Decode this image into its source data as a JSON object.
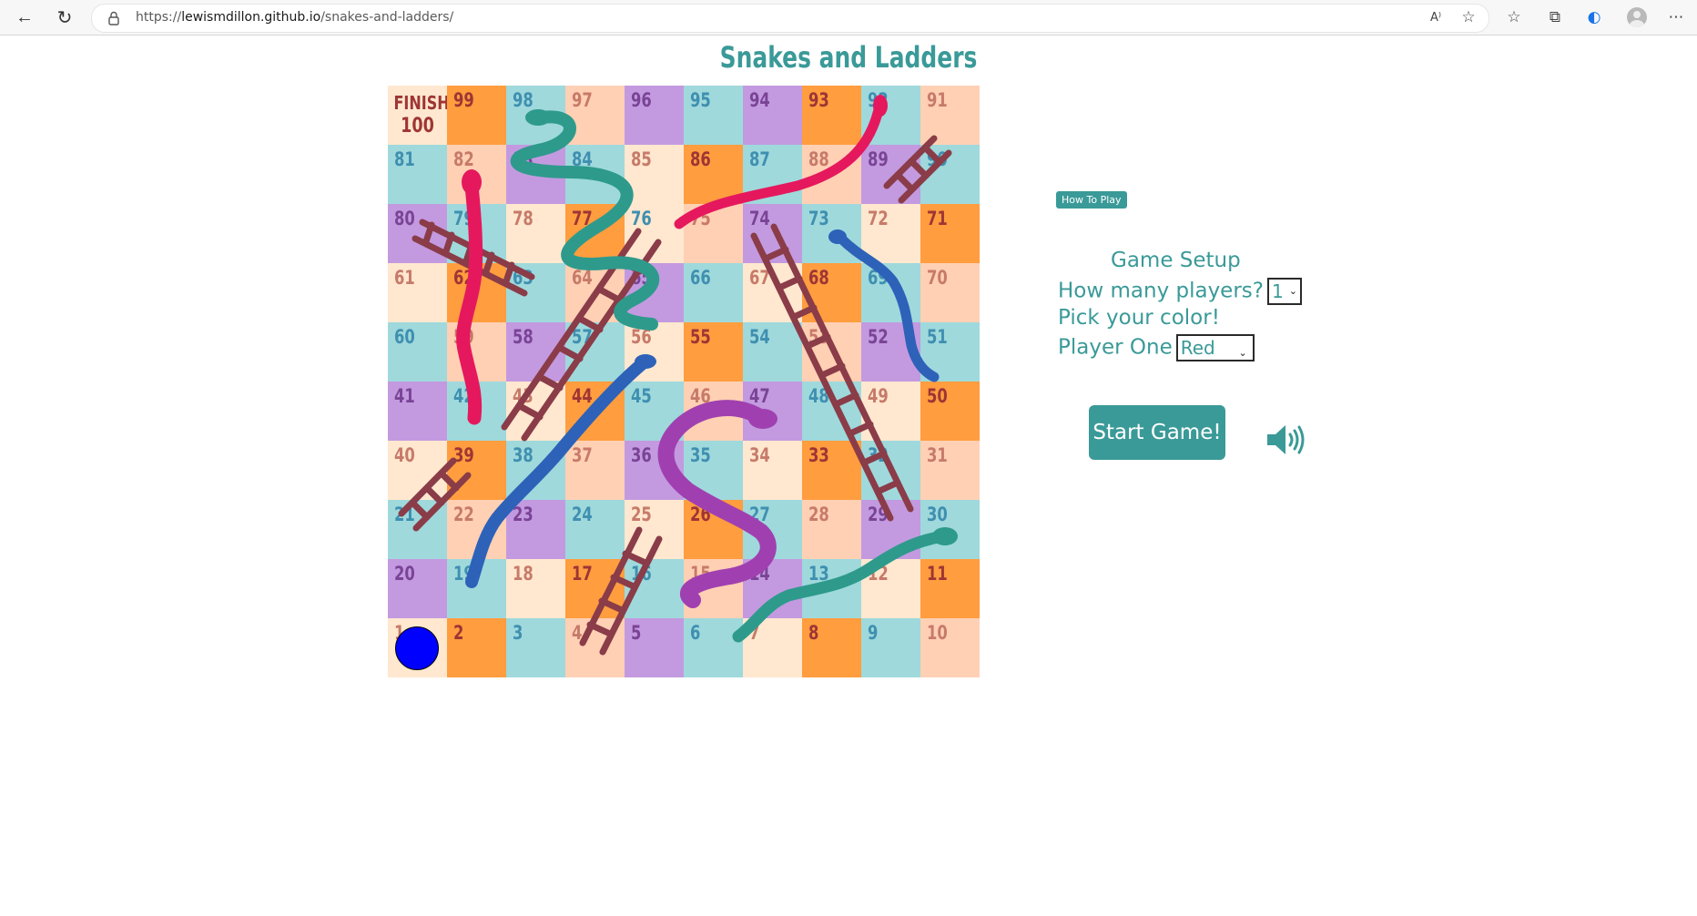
{
  "browser": {
    "url_prefix": "https://",
    "url_host": "lewismdillon.github.io",
    "url_path": "/snakes-and-ladders/"
  },
  "page": {
    "title": "Snakes and Ladders"
  },
  "board": {
    "finish_label": "FINISH",
    "cells": [
      {
        "n": "100",
        "bg": "#ffe8cf",
        "fg": "#9e3535"
      },
      {
        "n": "99",
        "bg": "#ff9d3f",
        "fg": "#9e3535"
      },
      {
        "n": "98",
        "bg": "#9fd9dc",
        "fg": "#3f8fb0"
      },
      {
        "n": "97",
        "bg": "#ffd0b4",
        "fg": "#c77a6a"
      },
      {
        "n": "96",
        "bg": "#c39ae0",
        "fg": "#7a4496"
      },
      {
        "n": "95",
        "bg": "#9fd9dc",
        "fg": "#3f8fb0"
      },
      {
        "n": "94",
        "bg": "#c39ae0",
        "fg": "#7a4496"
      },
      {
        "n": "93",
        "bg": "#ff9d3f",
        "fg": "#9e3535"
      },
      {
        "n": "92",
        "bg": "#9fd9dc",
        "fg": "#3f8fb0"
      },
      {
        "n": "91",
        "bg": "#ffd0b4",
        "fg": "#c77a6a"
      },
      {
        "n": "81",
        "bg": "#9fd9dc",
        "fg": "#3f8fb0"
      },
      {
        "n": "82",
        "bg": "#ffd0b4",
        "fg": "#c77a6a"
      },
      {
        "n": "83",
        "bg": "#c39ae0",
        "fg": "#7a4496"
      },
      {
        "n": "84",
        "bg": "#9fd9dc",
        "fg": "#3f8fb0"
      },
      {
        "n": "85",
        "bg": "#ffe8cf",
        "fg": "#c77a6a"
      },
      {
        "n": "86",
        "bg": "#ff9d3f",
        "fg": "#9e3535"
      },
      {
        "n": "87",
        "bg": "#9fd9dc",
        "fg": "#3f8fb0"
      },
      {
        "n": "88",
        "bg": "#ffd0b4",
        "fg": "#c77a6a"
      },
      {
        "n": "89",
        "bg": "#c39ae0",
        "fg": "#7a4496"
      },
      {
        "n": "90",
        "bg": "#9fd9dc",
        "fg": "#3f8fb0"
      },
      {
        "n": "80",
        "bg": "#c39ae0",
        "fg": "#7a4496"
      },
      {
        "n": "79",
        "bg": "#9fd9dc",
        "fg": "#3f8fb0"
      },
      {
        "n": "78",
        "bg": "#ffe8cf",
        "fg": "#c77a6a"
      },
      {
        "n": "77",
        "bg": "#ff9d3f",
        "fg": "#9e3535"
      },
      {
        "n": "76",
        "bg": "#ffe8cf",
        "fg": "#3f8fb0"
      },
      {
        "n": "75",
        "bg": "#ffd0b4",
        "fg": "#c77a6a"
      },
      {
        "n": "74",
        "bg": "#c39ae0",
        "fg": "#7a4496"
      },
      {
        "n": "73",
        "bg": "#9fd9dc",
        "fg": "#3f8fb0"
      },
      {
        "n": "72",
        "bg": "#ffe8cf",
        "fg": "#c77a6a"
      },
      {
        "n": "71",
        "bg": "#ff9d3f",
        "fg": "#9e3535"
      },
      {
        "n": "61",
        "bg": "#ffe8cf",
        "fg": "#c77a6a"
      },
      {
        "n": "62",
        "bg": "#ff9d3f",
        "fg": "#9e3535"
      },
      {
        "n": "63",
        "bg": "#9fd9dc",
        "fg": "#3f8fb0"
      },
      {
        "n": "64",
        "bg": "#ffd0b4",
        "fg": "#c77a6a"
      },
      {
        "n": "65",
        "bg": "#c39ae0",
        "fg": "#7a4496"
      },
      {
        "n": "66",
        "bg": "#9fd9dc",
        "fg": "#3f8fb0"
      },
      {
        "n": "67",
        "bg": "#ffe8cf",
        "fg": "#c77a6a"
      },
      {
        "n": "68",
        "bg": "#ff9d3f",
        "fg": "#9e3535"
      },
      {
        "n": "69",
        "bg": "#9fd9dc",
        "fg": "#3f8fb0"
      },
      {
        "n": "70",
        "bg": "#ffd0b4",
        "fg": "#c77a6a"
      },
      {
        "n": "60",
        "bg": "#9fd9dc",
        "fg": "#3f8fb0"
      },
      {
        "n": "59",
        "bg": "#ffd0b4",
        "fg": "#c77a6a"
      },
      {
        "n": "58",
        "bg": "#c39ae0",
        "fg": "#7a4496"
      },
      {
        "n": "57",
        "bg": "#9fd9dc",
        "fg": "#3f8fb0"
      },
      {
        "n": "56",
        "bg": "#ffe8cf",
        "fg": "#c77a6a"
      },
      {
        "n": "55",
        "bg": "#ff9d3f",
        "fg": "#9e3535"
      },
      {
        "n": "54",
        "bg": "#9fd9dc",
        "fg": "#3f8fb0"
      },
      {
        "n": "53",
        "bg": "#ffd0b4",
        "fg": "#c77a6a"
      },
      {
        "n": "52",
        "bg": "#c39ae0",
        "fg": "#7a4496"
      },
      {
        "n": "51",
        "bg": "#9fd9dc",
        "fg": "#3f8fb0"
      },
      {
        "n": "41",
        "bg": "#c39ae0",
        "fg": "#7a4496"
      },
      {
        "n": "42",
        "bg": "#9fd9dc",
        "fg": "#3f8fb0"
      },
      {
        "n": "43",
        "bg": "#ffe8cf",
        "fg": "#c77a6a"
      },
      {
        "n": "44",
        "bg": "#ff9d3f",
        "fg": "#9e3535"
      },
      {
        "n": "45",
        "bg": "#9fd9dc",
        "fg": "#3f8fb0"
      },
      {
        "n": "46",
        "bg": "#ffd0b4",
        "fg": "#c77a6a"
      },
      {
        "n": "47",
        "bg": "#c39ae0",
        "fg": "#7a4496"
      },
      {
        "n": "48",
        "bg": "#9fd9dc",
        "fg": "#3f8fb0"
      },
      {
        "n": "49",
        "bg": "#ffe8cf",
        "fg": "#c77a6a"
      },
      {
        "n": "50",
        "bg": "#ff9d3f",
        "fg": "#9e3535"
      },
      {
        "n": "40",
        "bg": "#ffe8cf",
        "fg": "#c77a6a"
      },
      {
        "n": "39",
        "bg": "#ff9d3f",
        "fg": "#9e3535"
      },
      {
        "n": "38",
        "bg": "#9fd9dc",
        "fg": "#3f8fb0"
      },
      {
        "n": "37",
        "bg": "#ffd0b4",
        "fg": "#c77a6a"
      },
      {
        "n": "36",
        "bg": "#c39ae0",
        "fg": "#7a4496"
      },
      {
        "n": "35",
        "bg": "#9fd9dc",
        "fg": "#3f8fb0"
      },
      {
        "n": "34",
        "bg": "#ffe8cf",
        "fg": "#c77a6a"
      },
      {
        "n": "33",
        "bg": "#ff9d3f",
        "fg": "#9e3535"
      },
      {
        "n": "32",
        "bg": "#9fd9dc",
        "fg": "#3f8fb0"
      },
      {
        "n": "31",
        "bg": "#ffd0b4",
        "fg": "#c77a6a"
      },
      {
        "n": "21",
        "bg": "#9fd9dc",
        "fg": "#3f8fb0"
      },
      {
        "n": "22",
        "bg": "#ffd0b4",
        "fg": "#c77a6a"
      },
      {
        "n": "23",
        "bg": "#c39ae0",
        "fg": "#7a4496"
      },
      {
        "n": "24",
        "bg": "#9fd9dc",
        "fg": "#3f8fb0"
      },
      {
        "n": "25",
        "bg": "#ffe8cf",
        "fg": "#c77a6a"
      },
      {
        "n": "26",
        "bg": "#ff9d3f",
        "fg": "#9e3535"
      },
      {
        "n": "27",
        "bg": "#9fd9dc",
        "fg": "#3f8fb0"
      },
      {
        "n": "28",
        "bg": "#ffd0b4",
        "fg": "#c77a6a"
      },
      {
        "n": "29",
        "bg": "#c39ae0",
        "fg": "#7a4496"
      },
      {
        "n": "30",
        "bg": "#9fd9dc",
        "fg": "#3f8fb0"
      },
      {
        "n": "20",
        "bg": "#c39ae0",
        "fg": "#7a4496"
      },
      {
        "n": "19",
        "bg": "#9fd9dc",
        "fg": "#3f8fb0"
      },
      {
        "n": "18",
        "bg": "#ffe8cf",
        "fg": "#c77a6a"
      },
      {
        "n": "17",
        "bg": "#ff9d3f",
        "fg": "#9e3535"
      },
      {
        "n": "16",
        "bg": "#9fd9dc",
        "fg": "#3f8fb0"
      },
      {
        "n": "15",
        "bg": "#ffd0b4",
        "fg": "#c77a6a"
      },
      {
        "n": "14",
        "bg": "#c39ae0",
        "fg": "#7a4496"
      },
      {
        "n": "13",
        "bg": "#9fd9dc",
        "fg": "#3f8fb0"
      },
      {
        "n": "12",
        "bg": "#ffe8cf",
        "fg": "#c77a6a"
      },
      {
        "n": "11",
        "bg": "#ff9d3f",
        "fg": "#9e3535"
      },
      {
        "n": "1",
        "bg": "#ffe8cf",
        "fg": "#c77a6a"
      },
      {
        "n": "2",
        "bg": "#ff9d3f",
        "fg": "#9e3535"
      },
      {
        "n": "3",
        "bg": "#9fd9dc",
        "fg": "#3f8fb0"
      },
      {
        "n": "4",
        "bg": "#ffd0b4",
        "fg": "#c77a6a"
      },
      {
        "n": "5",
        "bg": "#c39ae0",
        "fg": "#7a4496"
      },
      {
        "n": "6",
        "bg": "#9fd9dc",
        "fg": "#3f8fb0"
      },
      {
        "n": "7",
        "bg": "#ffe8cf",
        "fg": "#c77a6a"
      },
      {
        "n": "8",
        "bg": "#ff9d3f",
        "fg": "#9e3535"
      },
      {
        "n": "9",
        "bg": "#9fd9dc",
        "fg": "#3f8fb0"
      },
      {
        "n": "10",
        "bg": "#ffd0b4",
        "fg": "#c77a6a"
      }
    ],
    "player_token": {
      "color": "#0000ff",
      "square": "1"
    }
  },
  "setup": {
    "how_to_play_label": "How To Play",
    "heading": "Game Setup",
    "players_question": "How many players?",
    "players_value": "1",
    "pick_color_label": "Pick your color!",
    "player_one_label": "Player One",
    "player_one_color": "Red",
    "start_label": "Start Game!"
  },
  "colors": {
    "accent": "#3a9a98"
  }
}
